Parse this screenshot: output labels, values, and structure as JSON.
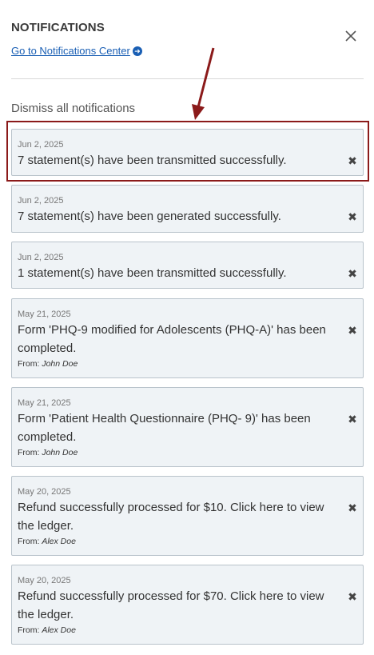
{
  "header": {
    "title": "NOTIFICATIONS",
    "center_link": "Go to Notifications Center",
    "center_link_icon": "arrow-circle-right-icon",
    "close_icon": "close-icon"
  },
  "dismiss_all": "Dismiss all notifications",
  "colors": {
    "card_bg": "#eff3f6",
    "card_border": "#b9c3cb",
    "link": "#1a5fb4",
    "annotation": "#8b1a1a"
  },
  "notifications": [
    {
      "date": "Jun 2, 2025",
      "message": "7 statement(s) have been transmitted successfully."
    },
    {
      "date": "Jun 2, 2025",
      "message": "7 statement(s) have been generated successfully."
    },
    {
      "date": "Jun 2, 2025",
      "message": "1 statement(s) have been transmitted successfully."
    },
    {
      "date": "May 21, 2025",
      "message": "Form 'PHQ-9 modified for Adolescents (PHQ-A)' has been completed.",
      "from_label": "From:",
      "from_name": "John Doe"
    },
    {
      "date": "May 21, 2025",
      "message": "Form 'Patient Health Questionnaire (PHQ- 9)' has been completed.",
      "from_label": "From:",
      "from_name": "John Doe"
    },
    {
      "date": "May 20, 2025",
      "message": "Refund successfully processed for $10. Click here to view the ledger.",
      "from_label": "From:",
      "from_name": "Alex Doe"
    },
    {
      "date": "May 20, 2025",
      "message": "Refund successfully processed for $70. Click here to view the ledger.",
      "from_label": "From:",
      "from_name": "Alex Doe"
    }
  ]
}
